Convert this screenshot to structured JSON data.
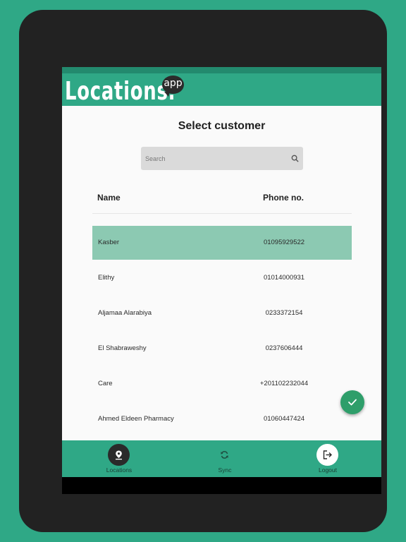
{
  "app": {
    "logo_text": "Locations.",
    "logo_badge": "app"
  },
  "page": {
    "title": "Select customer"
  },
  "search": {
    "placeholder": "Search",
    "value": ""
  },
  "table": {
    "headers": {
      "name": "Name",
      "phone": "Phone no."
    },
    "rows": [
      {
        "name": "Kasber",
        "phone": "01095929522",
        "selected": true
      },
      {
        "name": "Elithy",
        "phone": "01014000931",
        "selected": false
      },
      {
        "name": "Aljamaa Alarabiya",
        "phone": "0233372154",
        "selected": false
      },
      {
        "name": "El Shabraweshy",
        "phone": "0237606444",
        "selected": false
      },
      {
        "name": "Care",
        "phone": "+201102232044",
        "selected": false
      },
      {
        "name": "Ahmed Eldeen Pharmacy",
        "phone": "01060447424",
        "selected": false
      }
    ]
  },
  "fab": {
    "icon": "check-icon"
  },
  "nav": {
    "items": [
      {
        "label": "Locations",
        "icon": "location-pin-icon",
        "active": true
      },
      {
        "label": "Sync",
        "icon": "sync-icon",
        "active": false
      },
      {
        "label": "Logout",
        "icon": "logout-icon",
        "active": false
      }
    ]
  },
  "colors": {
    "background": "#2fa886",
    "header": "#2fa886",
    "selected_row": "#8cc9b2",
    "fab": "#2e9e6a",
    "device": "#222222"
  }
}
